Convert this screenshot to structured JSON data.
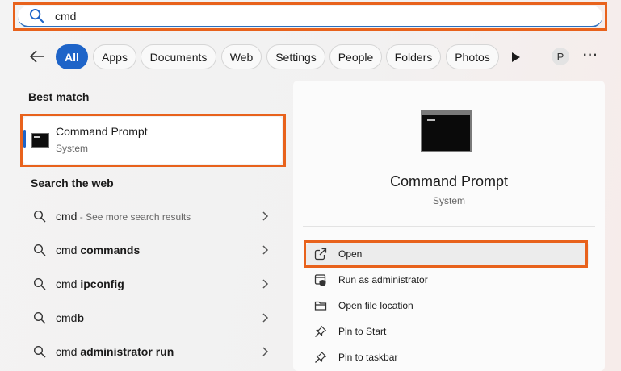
{
  "search": {
    "value": "cmd"
  },
  "filters": {
    "chips": [
      "All",
      "Apps",
      "Documents",
      "Web",
      "Settings",
      "People",
      "Folders",
      "Photos"
    ],
    "active": "All",
    "avatar_initial": "P",
    "more": "···"
  },
  "results": {
    "best_match_heading": "Best match",
    "best_match": {
      "title": "Command Prompt",
      "subtitle": "System"
    },
    "web_heading": "Search the web",
    "web_items": [
      {
        "prefix": "cmd",
        "bold": "",
        "hint": " - See more search results"
      },
      {
        "prefix": "cmd ",
        "bold": "commands",
        "hint": ""
      },
      {
        "prefix": "cmd ",
        "bold": "ipconfig",
        "hint": ""
      },
      {
        "prefix": "cmd",
        "bold": "b",
        "hint": ""
      },
      {
        "prefix": "cmd ",
        "bold": "administrator run",
        "hint": ""
      }
    ]
  },
  "detail": {
    "title": "Command Prompt",
    "subtitle": "System",
    "actions": [
      {
        "label": "Open",
        "icon": "open-external-icon"
      },
      {
        "label": "Run as administrator",
        "icon": "shield-admin-icon"
      },
      {
        "label": "Open file location",
        "icon": "folder-icon"
      },
      {
        "label": "Pin to Start",
        "icon": "pin-icon"
      },
      {
        "label": "Pin to taskbar",
        "icon": "pin-icon"
      }
    ]
  },
  "colors": {
    "accent": "#1e64c8",
    "highlight": "#e8621c"
  }
}
